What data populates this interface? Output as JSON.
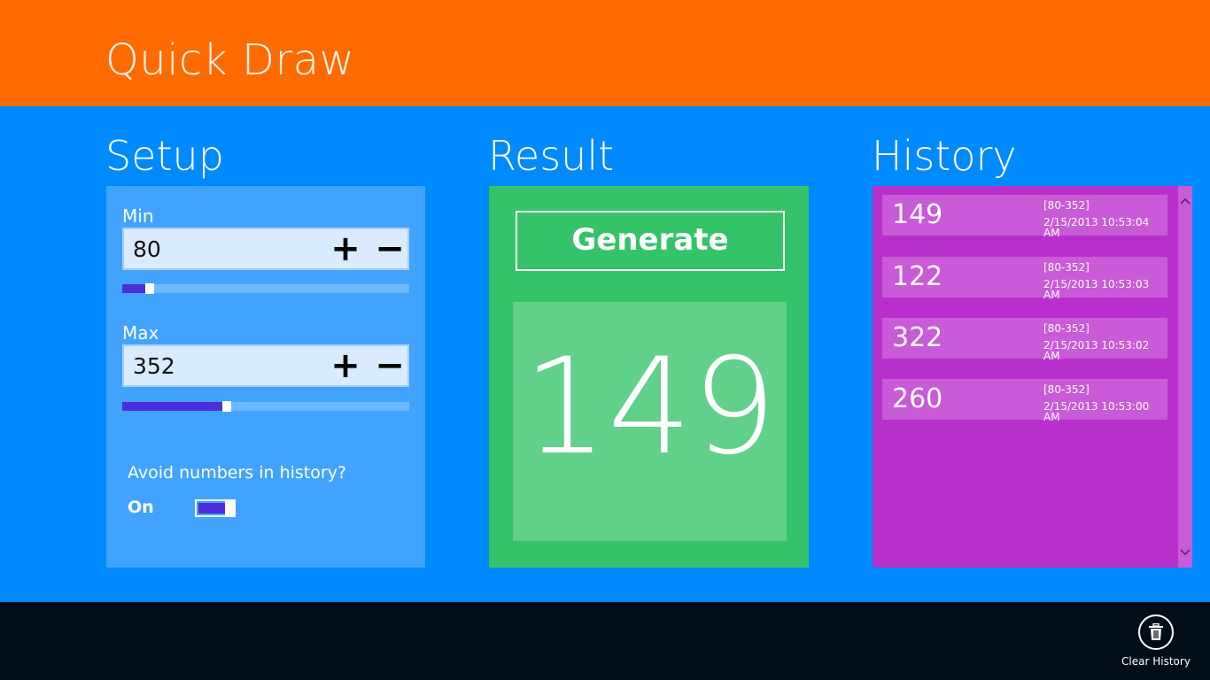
{
  "app": {
    "title": "Quick Draw",
    "colors": {
      "title_bar": "#FF6B00",
      "background": "#008AFF",
      "setup_panel": "#42A3FF",
      "result_panel": "#35C369",
      "history_panel": "#B830CC",
      "accent": "#4E2DDB",
      "app_bar": "#010E19"
    }
  },
  "setup": {
    "heading": "Setup",
    "min": {
      "label": "Min",
      "value": "80",
      "plus_icon": "+",
      "minus_icon": "−",
      "slider_fraction": 0.08
    },
    "max": {
      "label": "Max",
      "value": "352",
      "plus_icon": "+",
      "minus_icon": "−",
      "slider_fraction": 0.35
    },
    "avoid_history": {
      "question": "Avoid numbers in history?",
      "state": "On",
      "enabled": true
    }
  },
  "result": {
    "heading": "Result",
    "generate_label": "Generate",
    "value": "149"
  },
  "history": {
    "heading": "History",
    "items": [
      {
        "number": "149",
        "range": "[80-352]",
        "time": "2/15/2013 10:53:04 AM"
      },
      {
        "number": "122",
        "range": "[80-352]",
        "time": "2/15/2013 10:53:03 AM"
      },
      {
        "number": "322",
        "range": "[80-352]",
        "time": "2/15/2013 10:53:02 AM"
      },
      {
        "number": "260",
        "range": "[80-352]",
        "time": "2/15/2013 10:53:00 AM"
      }
    ],
    "scroll_up_icon": "chevron-up-icon",
    "scroll_down_icon": "chevron-down-icon"
  },
  "appbar": {
    "clear_history_label": "Clear History",
    "clear_history_icon": "trash-icon"
  }
}
